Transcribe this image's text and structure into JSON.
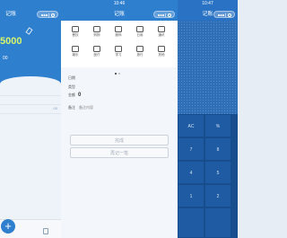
{
  "panel1": {
    "status_time": "",
    "nav_title": "记账",
    "balance_label": "",
    "balance_value": "5000",
    "income_label": "",
    "income_value": "00",
    "expense_label": "",
    "rows": [
      "",
      ".00",
      "",
      ""
    ],
    "tab_stats_label": "",
    "fab_symbol": "+"
  },
  "panel2": {
    "status_time": "10:46",
    "nav_title": "记账",
    "categories": [
      {
        "label": "餐饮",
        "icon": "food-icon"
      },
      {
        "label": "购物",
        "icon": "shopping-icon"
      },
      {
        "label": "服饰",
        "icon": "clothes-icon"
      },
      {
        "label": "日用",
        "icon": "daily-icon"
      },
      {
        "label": "通讯",
        "icon": "phone-icon"
      },
      {
        "label": "娱乐",
        "icon": "entertainment-icon"
      },
      {
        "label": "医疗",
        "icon": "medical-icon"
      },
      {
        "label": "学习",
        "icon": "study-icon"
      },
      {
        "label": "旅行",
        "icon": "travel-icon"
      },
      {
        "label": "其他",
        "icon": "other-icon"
      }
    ],
    "date_label": "日期",
    "date_value": "",
    "type_label": "类型",
    "type_value": "",
    "amount_label": "金额",
    "amount_value": "0",
    "note_label": "备注",
    "note_value": "备注内容",
    "done_button": "完成",
    "again_button": "再记一笔"
  },
  "panel3": {
    "status_time": "10:47",
    "nav_title": "记账",
    "keys": [
      "AC",
      "%",
      "7",
      "8",
      "4",
      "5",
      "1",
      "2"
    ]
  }
}
